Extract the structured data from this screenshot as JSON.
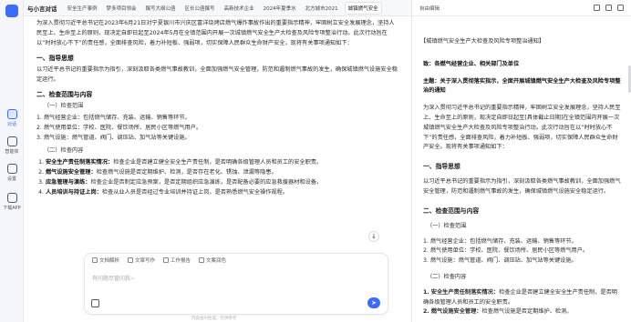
{
  "app": {
    "brand": "与小言对话"
  },
  "tabs": [
    "安全生产事例",
    "梦多项目领会",
    "撰写大纲公函",
    "区长公函撰写",
    "高新技术企业",
    "2024年夏季水",
    "北方城市2021",
    "城镇燃气安全"
  ],
  "rail": [
    {
      "label": "对话",
      "icon": "chat-icon"
    },
    {
      "label": "智能体",
      "icon": "agent-icon"
    },
    {
      "label": "设置",
      "icon": "gear-icon"
    },
    {
      "label": "下载APP",
      "icon": "download-icon"
    }
  ],
  "main": {
    "intro": "为深入贯彻习近平总书记在2023年6月21日对宁夏银川市兴庆区富洋烧烤店燃气爆炸事故作出的重要指示精神，牢固树立安全发展理念，坚持人民至上、生命至上的原则，现决定自即日起至2024年5月在全镇范围内开展一次城镇燃气安全生产大检查及风险专项整治行动。此次行动旨在以“时时放心不下”的责任感，全面排查风险，着力补短板、强弱项，切实保障人民群众生命财产安全，现将有关事项通知如下：",
    "s1_title": "一、指导思想",
    "s1_text": "以习近平总书记的重要指示为指引，深刻汲取各类燃气事故教训，全面加强燃气安全管理，防范和遏制燃气事故的发生，确保城镇燃气设施安全稳定运行。",
    "s2_title": "二、检查范围与内容",
    "s2_sub1": "（一）检查范围",
    "scope": [
      "1. 燃气经营企业：包括燃气储存、充装、运输、销售等环节。",
      "2. 燃气使用单位：学校、医院、餐饮场所、居民小区等燃气用户。",
      "3. 燃气设施：燃气管道、阀门、调压站、加气站等关键设施。"
    ],
    "s2_sub2": "（二）检查内容",
    "items": [
      {
        "head": "安全生产责任制落实情况：",
        "text": "检查企业是否建立健全安全生产责任制，是否明确各级管理人员和员工的安全职责。"
      },
      {
        "head": "燃气设施安全管理：",
        "text": "检查燃气设施是否定期维护、检测，是否存在老化、锈蚀、泄漏等隐患。"
      },
      {
        "head": "应急管理与演练：",
        "text": "检查企业是否制定应急预案，是否定期组织应急演练，是否配备必要的应急救援器材和设备。"
      },
      {
        "head": "人员培训与持证上岗：",
        "text": "检查从业人员是否经过专业培训并持证上岗，是否熟悉燃气安全操作规程。"
      }
    ]
  },
  "composer": {
    "chips": [
      "文档解析",
      "文章写作",
      "工作报告",
      "文案润色"
    ],
    "placeholder": "有问题尽管问我~",
    "send": "➤",
    "footer": "内容由AI生成，仅供参考"
  },
  "doc": {
    "header_label": "自由编辑",
    "title": "【城镇燃气安全生产大检查及风险专项整治通知】",
    "to": "致：各燃气经营企业、相关部门及单位",
    "subject": "主题：关于深入贯彻落实指示，全面开展城镇燃气安全生产大检查及风险专项整治的通知",
    "intro": "为深入贯彻习近平总书记的重要指示精神，牢固树立安全发展理念，坚持人民至上、生命至上的原则，现决定自即日起至[具体截止日期]在全镇范围内开展一次城镇燃气安全生产大检查及风险专项整治行动。此次行动旨在以“时时放心不下”的责任感，全面排查风险，着力补短板、强弱项，切实保障人民群众生命财产安全。现将有关事项通知如下：",
    "s1_title": "一、指导思想",
    "s1_text": "以习近平总书记的重要指示为指引，深刻汲取各类燃气事故教训，全面加强燃气安全管理，防范和遏制燃气事故的发生，确保城镇燃气设施安全稳定运行。",
    "s2_title": "二、检查范围与内容",
    "s2_sub1": "（一）检查范围",
    "scope": [
      "1. 燃气经营企业：包括燃气储存、充装、运输、销售等环节。",
      "2. 燃气使用单位：学校、医院、餐饮场所、居民小区等燃气用户。",
      "3. 燃气设施：燃气管道、阀门、调压站、加气站等关键设施。"
    ],
    "s2_sub2": "（二）检查内容",
    "items": [
      {
        "head": "1. 安全生产责任制落实情况：",
        "text": "检查企业是否建立健全安全生产责任制，是否明确各级管理人员和员工的安全职责。"
      },
      {
        "head": "2. 燃气设施安全管理：",
        "text": "检查燃气设施是否定期维护、检测。"
      }
    ]
  }
}
